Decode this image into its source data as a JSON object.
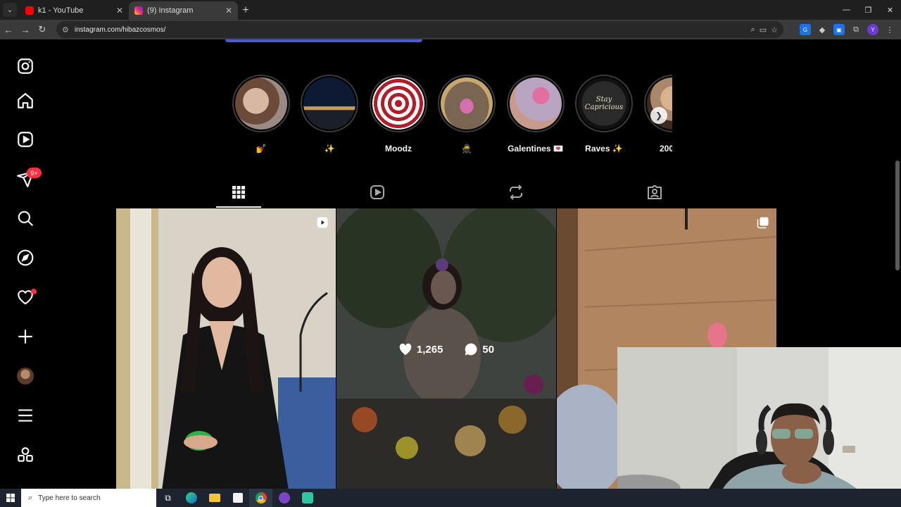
{
  "browser": {
    "tabs": [
      {
        "label": "k1 - YouTube",
        "favicon": "youtube-icon",
        "active": false
      },
      {
        "label": "(9) Instagram",
        "favicon": "instagram-icon",
        "active": true
      }
    ],
    "url": "instagram.com/hibazcosmos/"
  },
  "sidebar": {
    "notification_badge": "9+",
    "items": [
      "instagram-logo-icon",
      "home-icon",
      "reels-icon",
      "messages-icon",
      "search-icon",
      "explore-icon",
      "notifications-icon",
      "create-icon",
      "profile-avatar",
      "more-menu-icon",
      "threads-icon"
    ]
  },
  "highlights": [
    {
      "label": "💅",
      "colors": [
        "#c9a38a",
        "#6b4a3a"
      ]
    },
    {
      "label": "✨",
      "colors": [
        "#1a2540",
        "#c99a5a"
      ]
    },
    {
      "label": "Moodz",
      "colors": [
        "#ffffff",
        "#b01e2a"
      ]
    },
    {
      "label": "🥷",
      "colors": [
        "#7a6452",
        "#c6a86d"
      ]
    },
    {
      "label": "Galentines 💌",
      "colors": [
        "#b9a4c2",
        "#c79a8c"
      ]
    },
    {
      "label": "Raves ✨",
      "colors": [
        "#1a1a1a",
        "#e8e0c8"
      ]
    },
    {
      "label": "200",
      "colors": [
        "#a9876a",
        "#3a2a20"
      ]
    }
  ],
  "posts": [
    {
      "type": "reel",
      "likes": null,
      "comments": null
    },
    {
      "type": "photo",
      "likes": "1,265",
      "comments": "50"
    },
    {
      "type": "carousel",
      "likes": null,
      "comments": null
    }
  ],
  "taskbar": {
    "search_placeholder": "Type here to search"
  }
}
